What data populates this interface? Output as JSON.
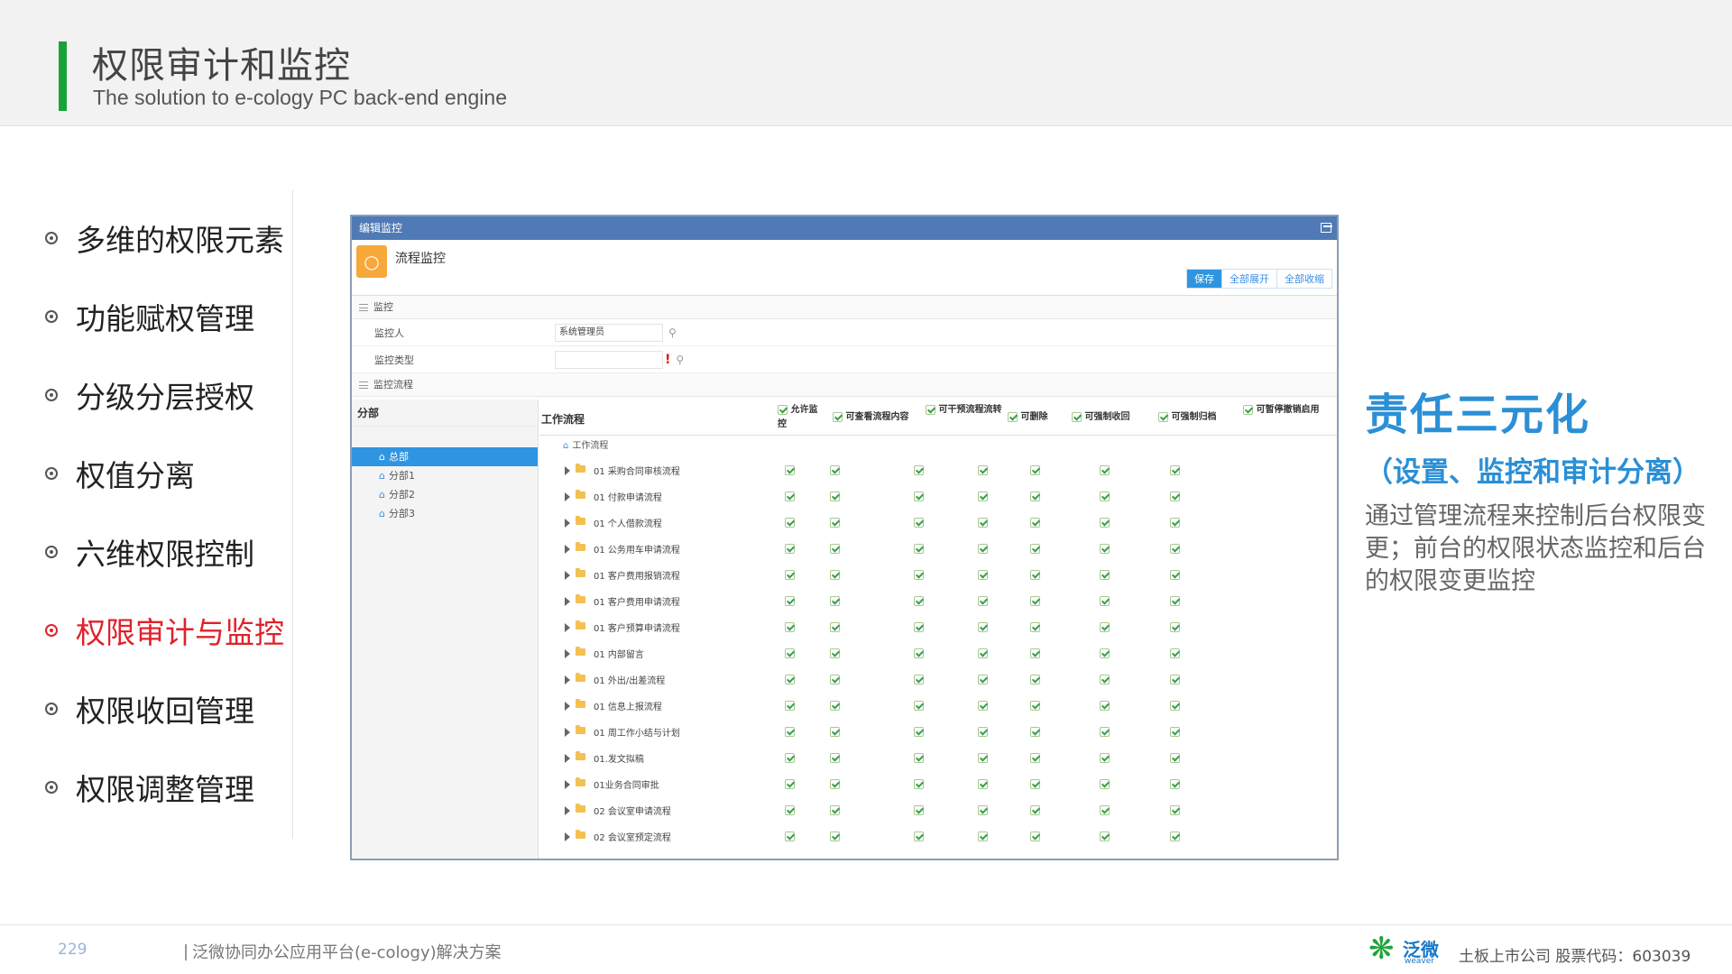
{
  "header": {
    "title": "权限审计和监控",
    "subtitle": "The solution to e-cology PC back-end engine"
  },
  "menu": {
    "items": [
      {
        "label": "多维的权限元素"
      },
      {
        "label": "功能赋权管理"
      },
      {
        "label": "分级分层授权"
      },
      {
        "label": "权值分离"
      },
      {
        "label": "六维权限控制"
      },
      {
        "label": "权限审计与监控",
        "active": true
      },
      {
        "label": "权限收回管理"
      },
      {
        "label": "权限调整管理"
      }
    ]
  },
  "panel": {
    "window_title": "编辑监控",
    "workflow_title": "流程监控",
    "buttons": {
      "save": "保存",
      "expand_all": "全部展开",
      "collapse_all": "全部收缩"
    },
    "section_monitor": "监控",
    "monitor_person_label": "监控人",
    "monitor_person_value": "系统管理员",
    "monitor_type_label": "监控类型",
    "monitor_type_value": "",
    "section_flow": "监控流程",
    "org": {
      "header": "分部",
      "nodes": [
        {
          "label": "总部",
          "selected": true
        },
        {
          "label": "分部1"
        },
        {
          "label": "分部2"
        },
        {
          "label": "分部3"
        }
      ]
    },
    "table": {
      "col0": "工作流程",
      "columns": [
        "允许监控",
        "可查看流程内容",
        "可干预流程流转",
        "可删除",
        "可强制收回",
        "可强制归档",
        "可暂停撤销启用"
      ],
      "root": "工作流程",
      "rows": [
        {
          "name": "01 采购合同审核流程"
        },
        {
          "name": "01 付款申请流程"
        },
        {
          "name": "01 个人借款流程"
        },
        {
          "name": "01 公务用车申请流程"
        },
        {
          "name": "01 客户费用报销流程"
        },
        {
          "name": "01 客户费用申请流程"
        },
        {
          "name": "01 客户预算申请流程"
        },
        {
          "name": "01 内部留言"
        },
        {
          "name": "01 外出/出差流程"
        },
        {
          "name": "01 信息上报流程"
        },
        {
          "name": "01 周工作小结与计划"
        },
        {
          "name": "01.发文拟稿"
        },
        {
          "name": "01业务合同审批"
        },
        {
          "name": "02 会议室申请流程"
        },
        {
          "name": "02 会议室预定流程"
        }
      ]
    }
  },
  "right": {
    "title": "责任三元化",
    "subtitle": "（设置、监控和审计分离）",
    "description": "通过管理流程来控制后台权限变更；前台的权限状态监控和后台的权限变更监控"
  },
  "footer": {
    "page_number": "229",
    "text": "泛微协同办公应用平台(e-cology)解决方案",
    "logo_text": "泛微",
    "logo_sub": "weaver",
    "company": "土板上市公司    股票代码：603039"
  },
  "colors": {
    "accent_green": "#18a23a",
    "accent_blue": "#2b8fd6",
    "active_red": "#e0212a"
  }
}
